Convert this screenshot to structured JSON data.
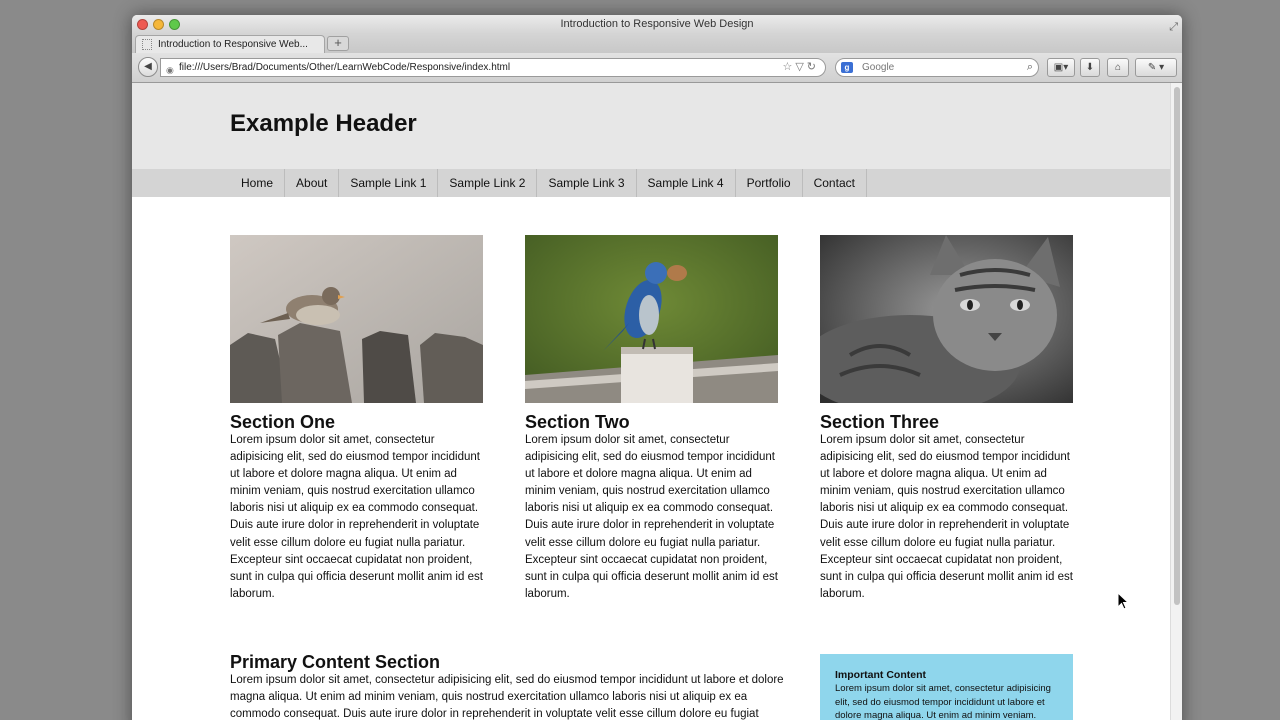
{
  "window": {
    "title": "Introduction to Responsive Web Design"
  },
  "tab": {
    "title": "Introduction to Responsive Web..."
  },
  "address": {
    "url": "file:///Users/Brad/Documents/Other/LearnWebCode/Responsive/index.html"
  },
  "search": {
    "engine_badge": "g",
    "placeholder": "Google"
  },
  "site": {
    "title": "Example Header",
    "nav": [
      "Home",
      "About",
      "Sample Link 1",
      "Sample Link 2",
      "Sample Link 3",
      "Sample Link 4",
      "Portfolio",
      "Contact"
    ],
    "sections": [
      {
        "heading": "Section One",
        "image": "sparrow-on-fence",
        "body": "Lorem ipsum dolor sit amet, consectetur adipisicing elit, sed do eiusmod tempor incididunt ut labore et dolore magna aliqua. Ut enim ad minim veniam, quis nostrud exercitation ullamco laboris nisi ut aliquip ex ea commodo consequat. Duis aute irure dolor in reprehenderit in voluptate velit esse cillum dolore eu fugiat nulla pariatur. Excepteur sint occaecat cupidatat non proident, sunt in culpa qui officia deserunt mollit anim id est laborum."
      },
      {
        "heading": "Section Two",
        "image": "blue-jay-on-post",
        "body": "Lorem ipsum dolor sit amet, consectetur adipisicing elit, sed do eiusmod tempor incididunt ut labore et dolore magna aliqua. Ut enim ad minim veniam, quis nostrud exercitation ullamco laboris nisi ut aliquip ex ea commodo consequat. Duis aute irure dolor in reprehenderit in voluptate velit esse cillum dolore eu fugiat nulla pariatur. Excepteur sint occaecat cupidatat non proident, sunt in culpa qui officia deserunt mollit anim id est laborum."
      },
      {
        "heading": "Section Three",
        "image": "tabby-cat",
        "body": "Lorem ipsum dolor sit amet, consectetur adipisicing elit, sed do eiusmod tempor incididunt ut labore et dolore magna aliqua. Ut enim ad minim veniam, quis nostrud exercitation ullamco laboris nisi ut aliquip ex ea commodo consequat. Duis aute irure dolor in reprehenderit in voluptate velit esse cillum dolore eu fugiat nulla pariatur. Excepteur sint occaecat cupidatat non proident, sunt in culpa qui officia deserunt mollit anim id est laborum."
      }
    ],
    "primary": {
      "heading": "Primary Content Section",
      "body": "Lorem ipsum dolor sit amet, consectetur adipisicing elit, sed do eiusmod tempor incididunt ut labore et dolore magna aliqua. Ut enim ad minim veniam, quis nostrud exercitation ullamco laboris nisi ut aliquip ex ea commodo consequat. Duis aute irure dolor in reprehenderit in voluptate velit esse cillum dolore eu fugiat"
    },
    "aside": {
      "heading": "Important Content",
      "body": "Lorem ipsum dolor sit amet, consectetur adipisicing elit, sed do eiusmod tempor incididunt ut labore et dolore magna aliqua. Ut enim ad minim veniam."
    }
  },
  "colors": {
    "header_bg": "#e7e7e7",
    "nav_bg": "#d4d4d4",
    "aside_bg": "#8fd6ec"
  }
}
